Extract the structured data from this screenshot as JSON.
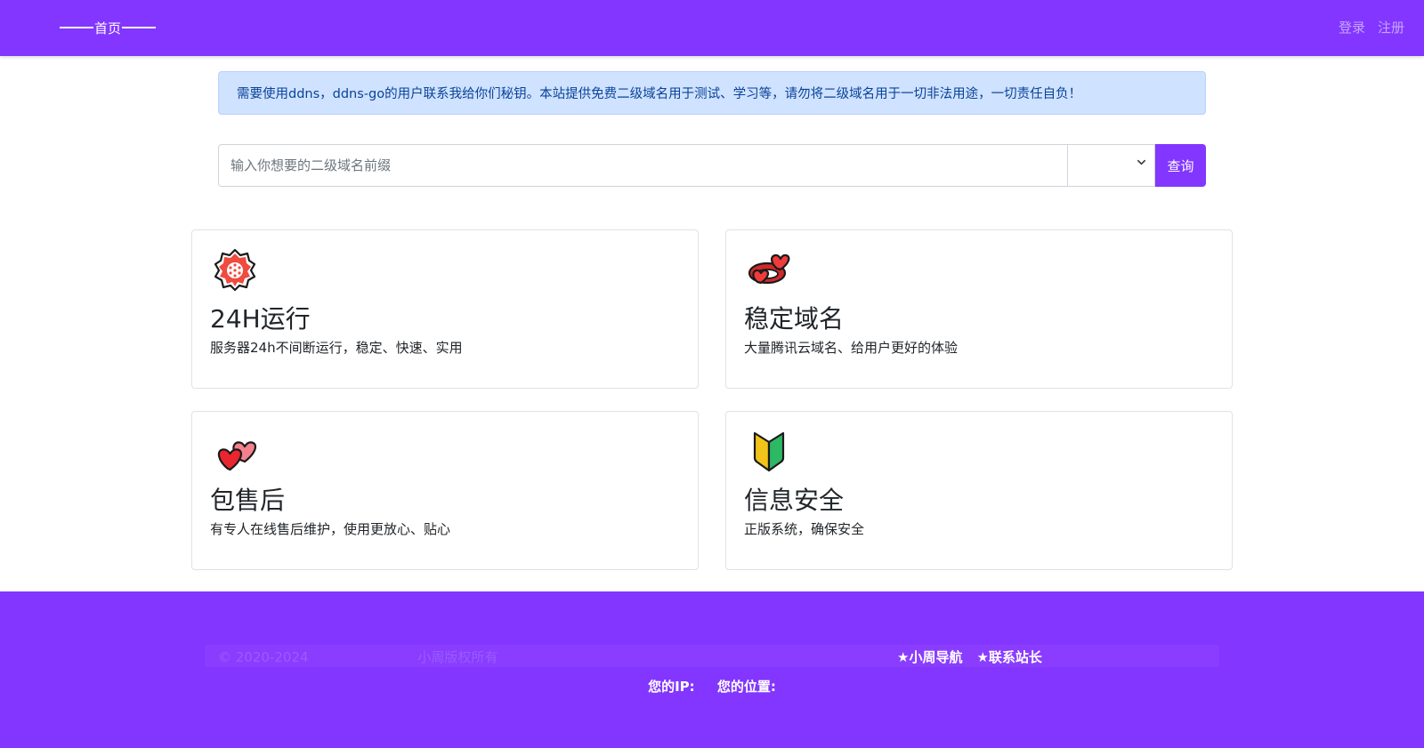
{
  "navbar": {
    "brand_label": "首页",
    "login_label": "登录",
    "register_label": "注册"
  },
  "alert": {
    "text": "需要使用ddns，ddns-go的用户联系我给你们秘钥。本站提供免费二级域名用于测试、学习等，请勿将二级域名用于一切非法用途，一切责任自负！"
  },
  "search": {
    "placeholder": "输入你想要的二级域名前缀",
    "value": "",
    "suffix_selected": "",
    "button_label": "查询"
  },
  "features": [
    {
      "icon": "cherry-blossom-badge-icon",
      "title": "24H运行",
      "desc": "服务器24h不间断运行，稳定、快速、实用"
    },
    {
      "icon": "heart-ring-icon",
      "title": "稳定域名",
      "desc": "大量腾讯云域名、给用户更好的体验"
    },
    {
      "icon": "two-hearts-icon",
      "title": "包售后",
      "desc": "有专人在线售后维护，使用更放心、贴心"
    },
    {
      "icon": "beginner-shield-icon",
      "title": "信息安全",
      "desc": "正版系统，确保安全"
    }
  ],
  "footer": {
    "copyright": "© 2020-2024",
    "owner": "小周版权所有",
    "links": [
      "★小周导航",
      "★联系站长"
    ],
    "ip_label": "您的IP:",
    "location_label": "您的位置:"
  },
  "colors": {
    "primary": "#8236ff",
    "alert_bg": "#cfe2ff",
    "alert_text": "#084298"
  }
}
